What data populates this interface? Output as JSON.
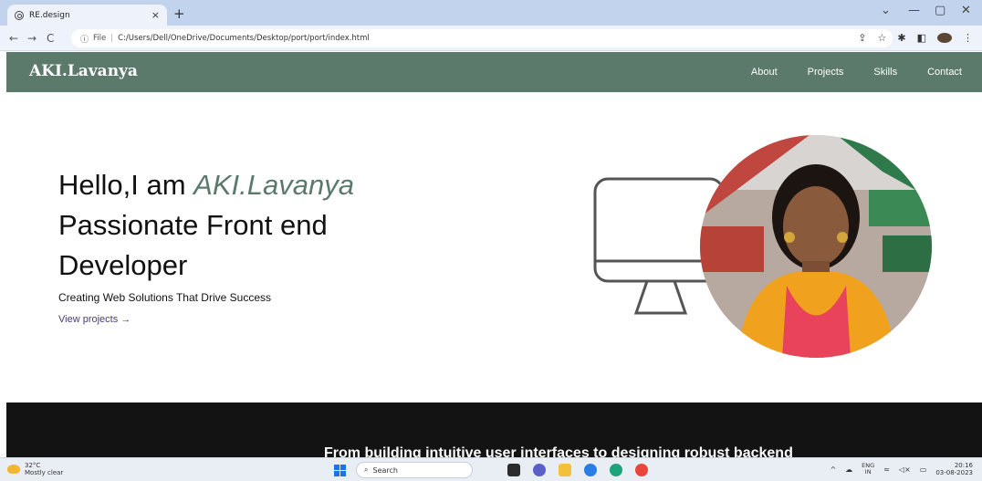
{
  "browser": {
    "tab_title": "RE.design",
    "tab_close": "×",
    "new_tab": "+",
    "url_scheme": "File",
    "url_path": "C:/Users/Dell/OneDrive/Documents/Desktop/port/port/index.html",
    "window_controls": [
      "⌄",
      "—",
      "▢",
      "✕"
    ]
  },
  "site": {
    "brand": "AKI.Lavanya",
    "nav": [
      "About",
      "Projects",
      "Skills",
      "Contact"
    ],
    "hero": {
      "greeting": "Hello,I am ",
      "name": "AKI.Lavanya",
      "headline": "Passionate Front end Developer",
      "tagline": "Creating Web Solutions That Drive Success",
      "cta": "View projects →"
    },
    "section_text": "From building intuitive user interfaces to designing robust backend"
  },
  "taskbar": {
    "weather_temp": "32°C",
    "weather_desc": "Mostly clear",
    "search_placeholder": "Search",
    "lang_top": "ENG",
    "lang_bottom": "IN",
    "time": "20:16",
    "date": "03-08-2023"
  },
  "colors": {
    "accent": "#5c7a6b",
    "link": "#4a3a78",
    "dark_section": "#131313"
  }
}
